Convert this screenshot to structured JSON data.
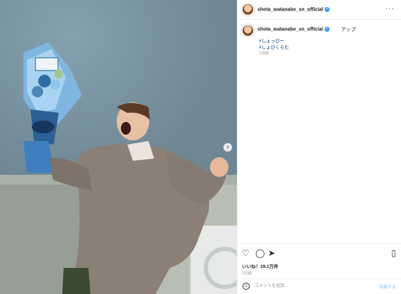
{
  "post": {
    "username": "shota_watanabe_sn_official",
    "caption_text": "アップ",
    "hashtags": [
      "#しょっぴー",
      "#しょぴくらむ"
    ],
    "time_ago": "1日前",
    "likes": "いいね！29.1万件",
    "date": "1日前"
  },
  "comment_box": {
    "placeholder": "コメントを追加...",
    "post_label": "投稿する",
    "emoji_icon": "smiley-icon"
  },
  "icons": {
    "more": "more-icon",
    "like": "heart-icon",
    "comment": "comment-icon",
    "share": "share-icon",
    "save": "bookmark-icon",
    "next": "chevron-right-icon",
    "verified": "verified-badge-icon"
  },
  "colors": {
    "verified": "#3897f0",
    "hashtag": "#00376b",
    "muted": "#8e8e8e"
  }
}
